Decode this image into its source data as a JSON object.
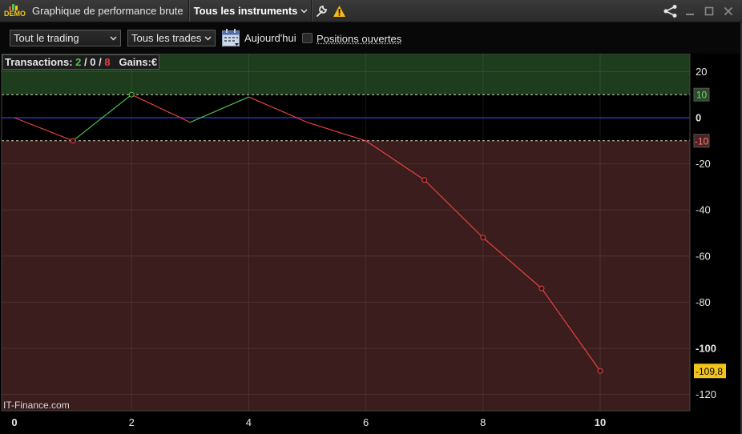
{
  "window": {
    "demo_badge": "DEMO",
    "title": "Graphique de performance brute",
    "instrument_selector": "Tous les instruments",
    "icons": [
      "wrench-icon",
      "warning-icon",
      "share-icon",
      "minimize-icon",
      "maximize-icon",
      "close-icon"
    ]
  },
  "toolbar": {
    "scope_select": "Tout le trading",
    "trades_select": "Tous les trades",
    "date_label": "Aujourd'hui",
    "open_positions_label": "Positions ouvertes",
    "open_positions_checked": false
  },
  "legend": {
    "transactions_label": "Transactions:",
    "wins": "2",
    "sep1": "/",
    "neutral": "0",
    "sep2": "/",
    "losses": "8",
    "gains_label": "Gains:",
    "gains_unit": "€"
  },
  "watermark": "IT-Finance.com",
  "colors": {
    "win": "#4ec24e",
    "loss": "#e84040",
    "zero_line": "#2f3fe0",
    "gain_zone": "#1d3d1d",
    "loss_zone": "#3b1d1d",
    "last_value_badge": "#f3c51c"
  },
  "chart_data": {
    "type": "line",
    "x": [
      0,
      1,
      2,
      3,
      4,
      5,
      6,
      7,
      8,
      9,
      10
    ],
    "y": [
      0,
      -10,
      10,
      -2,
      9,
      -2,
      -10,
      -27,
      -52,
      -74,
      -109.8
    ],
    "x_ticks": [
      "0",
      "2",
      "4",
      "6",
      "8",
      "10"
    ],
    "y_ticks": [
      "20",
      "10",
      "0",
      "-10",
      "-20",
      "-40",
      "-60",
      "-80",
      "-100",
      "-120"
    ],
    "upper_threshold": 10,
    "lower_threshold": -10,
    "last_value_label": "-109,8",
    "grid": true
  }
}
